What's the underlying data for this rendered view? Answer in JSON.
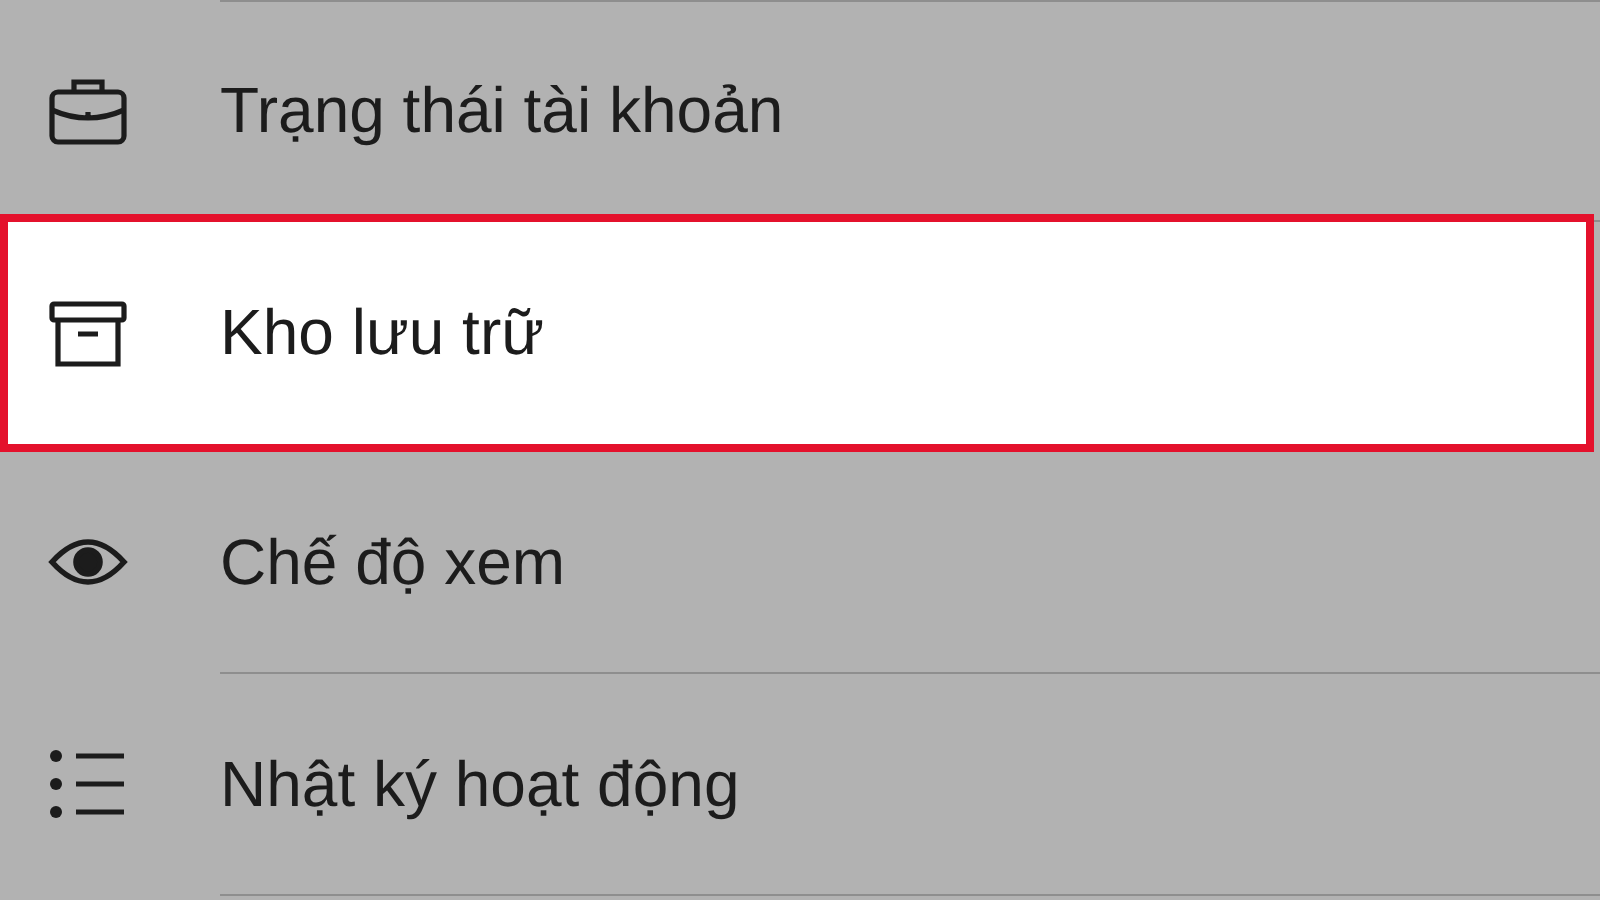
{
  "menu": {
    "items": [
      {
        "label": "Trạng thái tài khoản",
        "kind": "briefcase",
        "selected": false
      },
      {
        "label": "Kho lưu trữ",
        "kind": "archive",
        "selected": true
      },
      {
        "label": "Chế độ xem",
        "kind": "eye",
        "selected": false
      },
      {
        "label": "Nhật ký hoạt động",
        "kind": "list",
        "selected": false
      }
    ]
  }
}
